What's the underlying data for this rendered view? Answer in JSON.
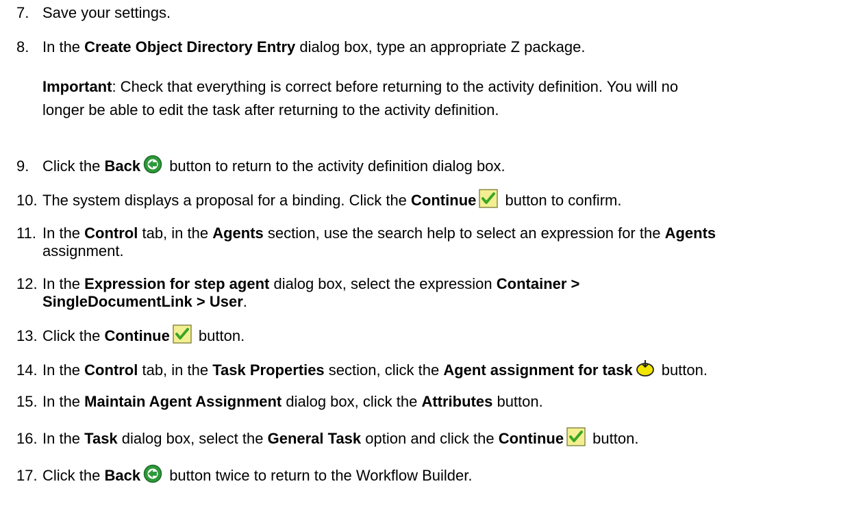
{
  "steps": {
    "s7": {
      "num": "7.",
      "a": "Save your settings."
    },
    "s8": {
      "num": "8.",
      "a": "In the ",
      "b1": "Create Object Directory Entry",
      "c": " dialog box, type an appropriate Z package."
    },
    "note": {
      "label": "Important",
      "text": ": Check that everything is correct before returning to the activity definition. You will no",
      "line2": "longer be able to edit the task after returning to the activity definition."
    },
    "s9": {
      "num": "9.",
      "a": "Click the ",
      "b1": "Back",
      "c": " button to return to the activity definition dialog box."
    },
    "s10": {
      "num": "10.",
      "a": "The system displays a proposal for a binding. Click the ",
      "b1": "Continue",
      "c": " button to confirm."
    },
    "s11": {
      "num": "11.",
      "a": "In the ",
      "b1": "Control",
      "c": " tab, in the ",
      "b2": "Agents",
      "d": " section, use the search help to select an expression for the ",
      "b3": "Agents",
      "line2": "assignment."
    },
    "s12": {
      "num": "12.",
      "a": "In the ",
      "b1": "Expression for step agent",
      "c": " dialog box, select the expression ",
      "b2": "Container >",
      "line2b": "SingleDocumentLink > User",
      "line2c": "."
    },
    "s13": {
      "num": "13.",
      "a": "Click the ",
      "b1": "Continue",
      "c": " button."
    },
    "s14": {
      "num": "14.",
      "a": "In the ",
      "b1": "Control",
      "c": " tab, in the ",
      "b2": "Task Properties",
      "d": " section, click the ",
      "b3": "Agent assignment for task",
      "e": " button."
    },
    "s15": {
      "num": "15.",
      "a": "In the ",
      "b1": "Maintain Agent Assignment",
      "c": " dialog box, click the ",
      "b2": "Attributes",
      "d": " button."
    },
    "s16": {
      "num": "16.",
      "a": "In the ",
      "b1": "Task",
      "c": " dialog box, select the ",
      "b2": "General Task",
      "d": " option and click the ",
      "b3": "Continue",
      "e": " button."
    },
    "s17": {
      "num": "17.",
      "a": "Click the ",
      "b1": "Back",
      "c": " button twice to return to the Workflow Builder."
    }
  },
  "icons": {
    "back": "back-arrow-icon",
    "continue": "checkmark-icon",
    "agent": "agent-assignment-icon"
  },
  "colors": {
    "back_icon": "#2e9a3a",
    "continue_icon_bg": "#f3ef90",
    "continue_check": "#3aa626",
    "agent_icon": "#f2e600"
  }
}
